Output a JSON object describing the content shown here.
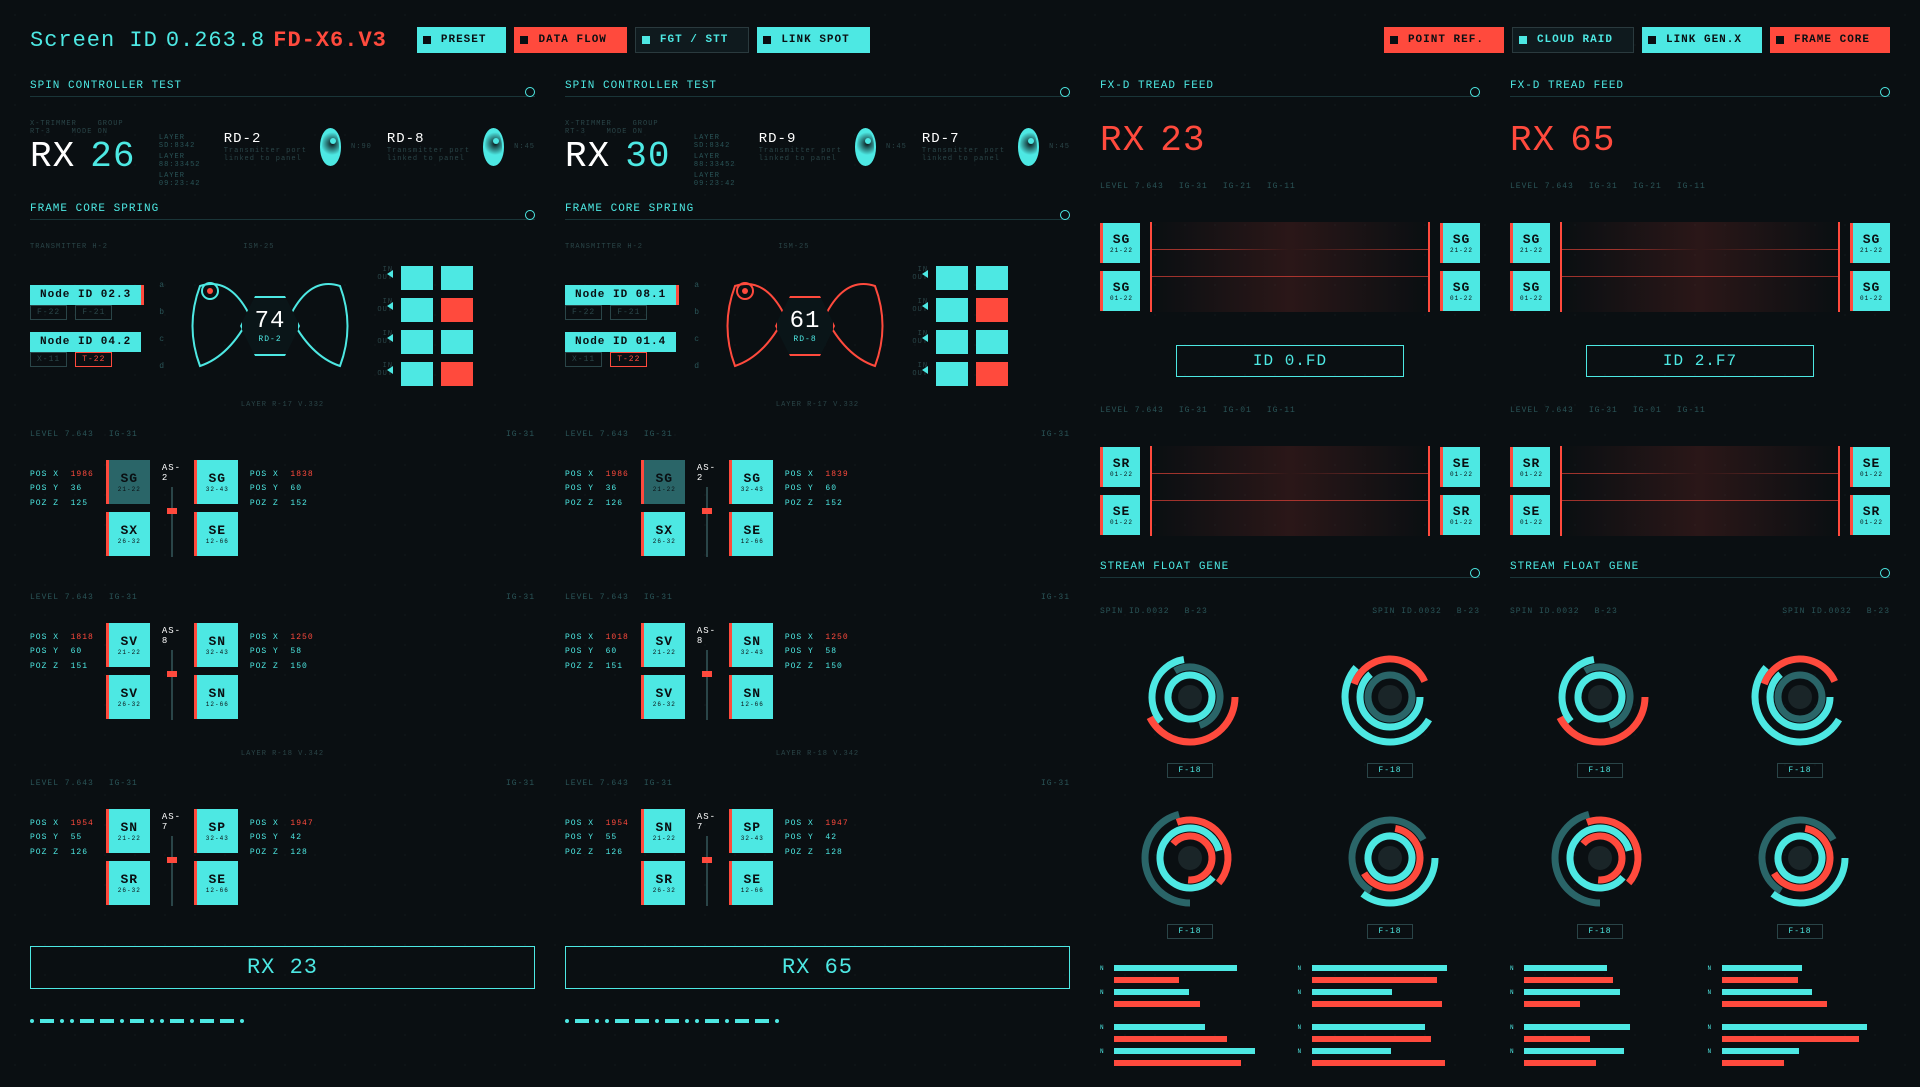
{
  "header": {
    "screen_id_label": "Screen ID",
    "screen_id": "0.263.8",
    "version": "FD-X6.V3"
  },
  "topbtns1": [
    {
      "label": "PRESET",
      "style": "cyan"
    },
    {
      "label": "DATA FLOW",
      "style": "red"
    },
    {
      "label": "FGT / STT",
      "style": "dark"
    },
    {
      "label": "LINK SPOT",
      "style": "cyan"
    }
  ],
  "topbtns2": [
    {
      "label": "POINT REF.",
      "style": "red"
    },
    {
      "label": "CLOUD RAID",
      "style": "dark"
    },
    {
      "label": "LINK GEN.X",
      "style": "cyan"
    },
    {
      "label": "FRAME CORE",
      "style": "red"
    }
  ],
  "panelA": {
    "title": "SPIN CONTROLLER TEST",
    "rx": "26",
    "rd": [
      {
        "l": "RD-2",
        "n": "N:90"
      },
      {
        "l": "RD-8",
        "n": "N:45"
      }
    ],
    "fcs": "FRAME CORE SPRING",
    "nodes": [
      {
        "id": "Node ID 02.3",
        "f": [
          "F-22",
          "F-21"
        ]
      },
      {
        "id": "Node ID 04.2",
        "f": [
          "X-11",
          "T-22"
        ]
      }
    ],
    "hex": {
      "n": "74",
      "s": "RD-2"
    },
    "layer1": "LAYER R-17 V.332",
    "layer2": "LAYER R-18 V.342",
    "stats1": {
      "x": "1986",
      "y": "36",
      "z": "125"
    },
    "stats2": {
      "x": "1838",
      "y": "60",
      "z": "152"
    },
    "stats3": {
      "x": "1818",
      "y": "60",
      "z": "151"
    },
    "stats4": {
      "x": "1250",
      "y": "58",
      "z": "150"
    },
    "stats5": {
      "x": "1954",
      "y": "55",
      "z": "126"
    },
    "stats6": {
      "x": "1947",
      "y": "42",
      "z": "128"
    },
    "tiles1": [
      [
        "SG",
        "21-22",
        "dim"
      ],
      [
        "SX",
        "26-32",
        ""
      ]
    ],
    "tiles2": [
      [
        "SG",
        "32-43",
        ""
      ],
      [
        "SE",
        "12-66",
        ""
      ]
    ],
    "tiles3": [
      [
        "SV",
        "21-22",
        ""
      ],
      [
        "SV",
        "26-32",
        ""
      ]
    ],
    "tiles4": [
      [
        "SN",
        "32-43",
        ""
      ],
      [
        "SN",
        "12-66",
        ""
      ]
    ],
    "tiles5": [
      [
        "SN",
        "21-22",
        ""
      ],
      [
        "SR",
        "26-32",
        ""
      ]
    ],
    "tiles6": [
      [
        "SP",
        "32-43",
        ""
      ],
      [
        "SE",
        "12-66",
        ""
      ]
    ],
    "sliders": [
      "AS-2",
      "AS-8",
      "AS-7"
    ],
    "rxbar": "RX 23",
    "level": "LEVEL 7.643"
  },
  "panelB": {
    "title": "SPIN CONTROLLER TEST",
    "rx": "30",
    "rd": [
      {
        "l": "RD-9",
        "n": "N:45"
      },
      {
        "l": "RD-7",
        "n": "N:45"
      }
    ],
    "fcs": "FRAME CORE SPRING",
    "nodes": [
      {
        "id": "Node ID 08.1",
        "f": [
          "F-22",
          "F-21"
        ]
      },
      {
        "id": "Node ID 01.4",
        "f": [
          "X-11",
          "T-22"
        ]
      }
    ],
    "hex": {
      "n": "61",
      "s": "RD-8"
    },
    "layer1": "LAYER R-17 V.332",
    "layer2": "LAYER R-18 V.342",
    "stats1": {
      "x": "1986",
      "y": "36",
      "z": "126"
    },
    "stats2": {
      "x": "1839",
      "y": "60",
      "z": "152"
    },
    "stats3": {
      "x": "1018",
      "y": "60",
      "z": "151"
    },
    "stats4": {
      "x": "1250",
      "y": "58",
      "z": "150"
    },
    "stats5": {
      "x": "1954",
      "y": "55",
      "z": "126"
    },
    "stats6": {
      "x": "1947",
      "y": "42",
      "z": "128"
    },
    "tiles1": [
      [
        "SG",
        "21-22",
        "dim"
      ],
      [
        "SX",
        "26-32",
        ""
      ]
    ],
    "tiles2": [
      [
        "SG",
        "32-43",
        ""
      ],
      [
        "SE",
        "12-66",
        ""
      ]
    ],
    "tiles3": [
      [
        "SV",
        "21-22",
        ""
      ],
      [
        "SV",
        "26-32",
        ""
      ]
    ],
    "tiles4": [
      [
        "SN",
        "32-43",
        ""
      ],
      [
        "SN",
        "12-66",
        ""
      ]
    ],
    "tiles5": [
      [
        "SN",
        "21-22",
        ""
      ],
      [
        "SR",
        "26-32",
        ""
      ]
    ],
    "tiles6": [
      [
        "SP",
        "32-43",
        ""
      ],
      [
        "SE",
        "12-66",
        ""
      ]
    ],
    "sliders": [
      "AS-2",
      "AS-8",
      "AS-7"
    ],
    "rxbar": "RX 65",
    "level": "LEVEL 7.643"
  },
  "feedA": {
    "title": "FX-D TREAD FEED",
    "rx": "23",
    "level": "LEVEL 7.643",
    "ig": [
      "IG-31",
      "IG-21",
      "IG-11"
    ],
    "sg1": [
      [
        "SG",
        "21-22"
      ],
      [
        "SG",
        "01-22"
      ]
    ],
    "sg2": [
      [
        "SG",
        "21-22"
      ],
      [
        "SG",
        "01-22"
      ]
    ],
    "id": "ID 0.FD",
    "sr": [
      [
        "SR",
        "01-22"
      ],
      [
        "SE",
        "01-22"
      ]
    ],
    "se": [
      [
        "SE",
        "01-22"
      ],
      [
        "SR",
        "01-22"
      ]
    ],
    "stream": "STREAM FLOAT GENE",
    "spinid": "SPIN ID.0032",
    "rlabels": [
      "F-18",
      "F-18",
      "F-18",
      "F-18"
    ]
  },
  "feedB": {
    "title": "FX-D TREAD FEED",
    "rx": "65",
    "level": "LEVEL 7.643",
    "ig": [
      "IG-31",
      "IG-21",
      "IG-11"
    ],
    "sg1": [
      [
        "SG",
        "21-22"
      ],
      [
        "SG",
        "01-22"
      ]
    ],
    "sg2": [
      [
        "SG",
        "21-22"
      ],
      [
        "SG",
        "01-22"
      ]
    ],
    "id": "ID 2.F7",
    "sr": [
      [
        "SR",
        "01-22"
      ],
      [
        "SE",
        "01-22"
      ]
    ],
    "se": [
      [
        "SE",
        "01-22"
      ],
      [
        "SR",
        "01-22"
      ]
    ],
    "stream": "STREAM FLOAT GENE",
    "spinid": "SPIN ID.0032",
    "rlabels": [
      "F-18",
      "F-18",
      "F-18",
      "F-18"
    ]
  },
  "micro": {
    "xt": "X-TRIMMER",
    "grp": "GROUP RT-3",
    "mod": "MODE ON",
    "ls": "LAYER SD:8342",
    "lr": "LAYER 88:33452",
    "lv": "LAYER 09:23:42",
    "tp": "Transmitter port linked to panel",
    "tr": "TRANSMITTER H-2",
    "ism": "ISM-25",
    "er": "ER-R",
    "tb": "T-800"
  }
}
